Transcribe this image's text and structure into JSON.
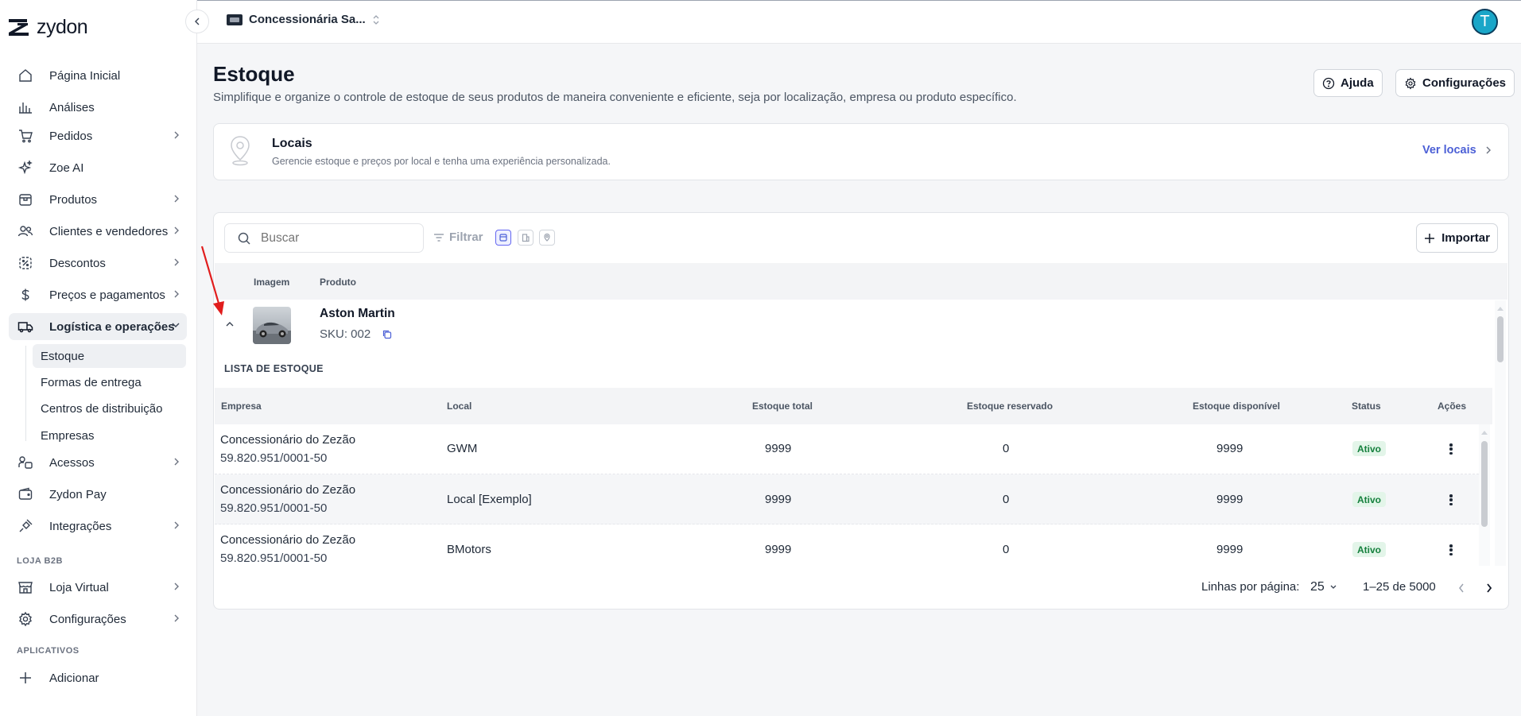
{
  "app": {
    "logo_text": "zydon"
  },
  "topbar": {
    "store_name": "Concessionária Sa...",
    "avatar_letter": "T"
  },
  "sidebar": {
    "items": [
      {
        "label": "Página Inicial"
      },
      {
        "label": "Análises"
      },
      {
        "label": "Pedidos"
      },
      {
        "label": "Zoe AI"
      },
      {
        "label": "Produtos"
      },
      {
        "label": "Clientes e vendedores"
      },
      {
        "label": "Descontos"
      },
      {
        "label": "Preços e pagamentos"
      },
      {
        "label": "Logística e operações"
      },
      {
        "label": "Acessos"
      },
      {
        "label": "Zydon Pay"
      },
      {
        "label": "Integrações"
      },
      {
        "label": "Loja Virtual"
      },
      {
        "label": "Configurações"
      },
      {
        "label": "Adicionar"
      }
    ],
    "sub_items": [
      {
        "label": "Estoque"
      },
      {
        "label": "Formas de entrega"
      },
      {
        "label": "Centros de distribuição"
      },
      {
        "label": "Empresas"
      }
    ],
    "section_b2b": "LOJA B2B",
    "section_apps": "APLICATIVOS"
  },
  "header": {
    "title": "Estoque",
    "subtitle": "Simplifique e organize o controle de estoque de seus produtos de maneira conveniente e eficiente, seja por localização, empresa ou produto específico.",
    "help_label": "Ajuda",
    "settings_label": "Configurações"
  },
  "locais": {
    "title": "Locais",
    "subtitle": "Gerencie estoque e preços por local e tenha uma experiência personalizada.",
    "link_label": "Ver locais"
  },
  "toolbar": {
    "search_placeholder": "Buscar",
    "filter_label": "Filtrar",
    "import_label": "Importar"
  },
  "table": {
    "col_image": "Imagem",
    "col_product": "Produto",
    "product": {
      "name": "Aston Martin",
      "sku": "SKU: 002"
    },
    "list_label": "LISTA DE ESTOQUE",
    "sub_columns": {
      "empresa": "Empresa",
      "local": "Local",
      "total": "Estoque total",
      "reservado": "Estoque reservado",
      "disponivel": "Estoque disponível",
      "status": "Status",
      "acoes": "Ações"
    },
    "rows": [
      {
        "empresa": "Concessionário do Zezão",
        "cnpj": "59.820.951/0001-50",
        "local": "GWM",
        "total": "9999",
        "reservado": "0",
        "disponivel": "9999",
        "status": "Ativo"
      },
      {
        "empresa": "Concessionário do Zezão",
        "cnpj": "59.820.951/0001-50",
        "local": "Local [Exemplo]",
        "total": "9999",
        "reservado": "0",
        "disponivel": "9999",
        "status": "Ativo"
      },
      {
        "empresa": "Concessionário do Zezão",
        "cnpj": "59.820.951/0001-50",
        "local": "BMotors",
        "total": "9999",
        "reservado": "0",
        "disponivel": "9999",
        "status": "Ativo"
      }
    ]
  },
  "pagination": {
    "rows_per_page_label": "Linhas por página:",
    "rows_per_page_value": "25",
    "range": "1–25 de 5000"
  },
  "colors": {
    "accent": "#4b5fd6",
    "active_badge_bg": "#e3f5e9",
    "active_badge_text": "#15803d",
    "annotation_arrow": "#e11d1d"
  }
}
